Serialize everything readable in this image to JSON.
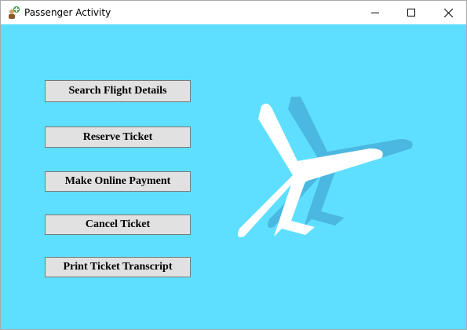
{
  "window": {
    "title": "Passenger Activity",
    "icon": "passenger-app-icon",
    "controls": [
      "minimize-icon",
      "maximize-icon",
      "close-icon"
    ]
  },
  "menu": {
    "search_flight_details": "Search Flight Details",
    "reserve_ticket": "Reserve Ticket",
    "make_online_payment": "Make Online Payment",
    "cancel_ticket": "Cancel Ticket",
    "print_ticket_transcript": "Print Ticket Transcript"
  },
  "decoration": {
    "illustration": "airplane-icon",
    "colors": {
      "background": "#5fdfff",
      "plane": "#ffffff",
      "plane_shadow": "#4bb8e2",
      "button_face": "#e1e1e1"
    }
  }
}
